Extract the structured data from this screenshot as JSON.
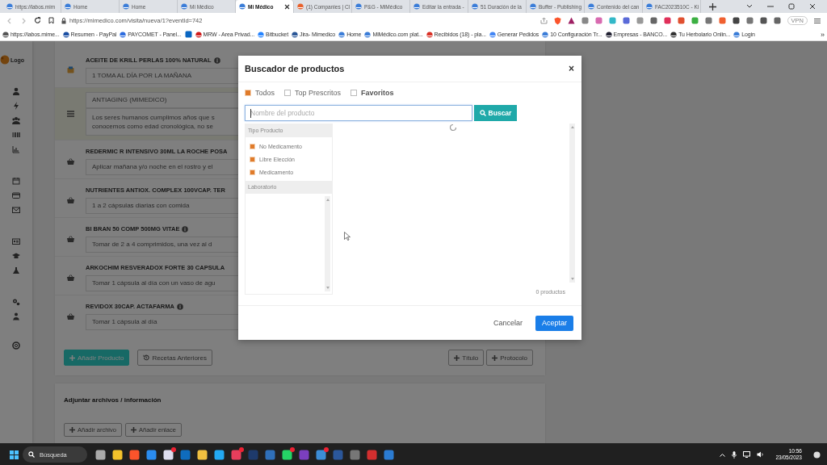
{
  "browser": {
    "tabs": [
      {
        "title": "https://labos.mim",
        "selected": false
      },
      {
        "title": "Home",
        "selected": false
      },
      {
        "title": "Home",
        "selected": false
      },
      {
        "title": "Mi Médico",
        "selected": false
      },
      {
        "title": "Mi Médico",
        "selected": true
      },
      {
        "title": "(1) Companies | Cl",
        "selected": false
      },
      {
        "title": "P&G - MiMédico",
        "selected": false
      },
      {
        "title": "Editar la entrada -",
        "selected": false
      },
      {
        "title": "51 Duración de la",
        "selected": false
      },
      {
        "title": "Buffer - Publishing",
        "selected": false
      },
      {
        "title": "Contenido del can",
        "selected": false
      },
      {
        "title": "FAC2023510C - Ki",
        "selected": false
      }
    ],
    "url": "https://mimedico.com/visita/nueva/1?eventId=742",
    "vpn_label": "VPN",
    "bookmarks": [
      {
        "kind": "link",
        "label": "https://labos.mime..."
      },
      {
        "kind": "link",
        "label": "Resumen - PayPal"
      },
      {
        "kind": "link",
        "label": "PAYCOMET - Panel..."
      },
      {
        "kind": "icon"
      },
      {
        "kind": "link",
        "label": "MRW - Area Privad..."
      },
      {
        "kind": "link",
        "label": "Bitbucket"
      },
      {
        "kind": "link",
        "label": "Jira- Mimedico"
      },
      {
        "kind": "link",
        "label": "Home"
      },
      {
        "kind": "link",
        "label": "MiMédico.com plat..."
      },
      {
        "kind": "link",
        "label": "Recibidos (18) - pla..."
      },
      {
        "kind": "link",
        "label": "Generar Pedidos"
      },
      {
        "kind": "link",
        "label": "10 Configuración Tr..."
      },
      {
        "kind": "link",
        "label": "Empresas - BANCO..."
      },
      {
        "kind": "link",
        "label": "Tu Herbolario Onlin..."
      },
      {
        "kind": "link",
        "label": "Login"
      }
    ],
    "more_bookmarks": "»"
  },
  "sidebar": {
    "logo_text": "Logo"
  },
  "prescription": {
    "items": [
      {
        "kind": "product",
        "title": "ACEITE DE KRILL PERLAS 100% NATURAL",
        "info": true,
        "dose": "1 TOMA AL DÍA POR LA MAÑANA"
      },
      {
        "kind": "protocol",
        "title": "ANTIAGING (MIMEDICO)",
        "description": "Los seres humanos cumplimos años que s\nconocemos como edad cronológica, no se"
      },
      {
        "kind": "product",
        "title": "REDERMIC R INTENSIVO 30ML LA ROCHE POSA",
        "info": false,
        "dose": "Aplicar mañana y/o noche en el rostro y el"
      },
      {
        "kind": "product",
        "title": "NUTRIENTES ANTIOX. COMPLEX 100VCAP. TER",
        "info": false,
        "dose": "1 a 2 cápsulas diarias con comida"
      },
      {
        "kind": "product",
        "title": "BI BRAN 50 COMP 500MG VITAE",
        "info": true,
        "dose": "Tomar de 2 a 4 comprimidos, una vez al d"
      },
      {
        "kind": "product",
        "title": "ARKOCHIM RESVERADOX FORTE 30 CAPSULA",
        "info": false,
        "dose": "Tomar 1 cápsula al día con un vaso de agu"
      },
      {
        "kind": "product",
        "title": "REVIDOX 30CAP. ACTAFARMA",
        "info": true,
        "dose": "Tomar 1 cápsula al día"
      }
    ],
    "add_product": "Añadir Producto",
    "previous_recipes": "Recetas Anteriores",
    "add_title": "Título",
    "add_protocol": "Protocolo"
  },
  "attachments": {
    "title": "Adjuntar archivos / información",
    "buttons": [
      "Añadir archivo",
      "Añadir enlace"
    ]
  },
  "modal": {
    "title": "Buscador de productos",
    "close": "×",
    "filters": [
      {
        "label": "Todos",
        "checked": true,
        "emphasis": false
      },
      {
        "label": "Top Prescritos",
        "checked": false,
        "emphasis": false
      },
      {
        "label": "Favoritos",
        "checked": false,
        "emphasis": true
      }
    ],
    "search_placeholder": "Nombre del producto",
    "search_button": "Buscar",
    "product_type_header": "Tipo Producto",
    "product_types": [
      {
        "label": "No Medicamento",
        "checked": true
      },
      {
        "label": "Libre Elección",
        "checked": true
      },
      {
        "label": "Medicamento",
        "checked": true
      }
    ],
    "laboratory_header": "Laboratorio",
    "loading": true,
    "count": "0 productos",
    "cancel": "Cancelar",
    "accept": "Aceptar"
  },
  "taskbar": {
    "search_placeholder": "Búsqueda",
    "time": "10:56",
    "date": "23/05/2023"
  }
}
